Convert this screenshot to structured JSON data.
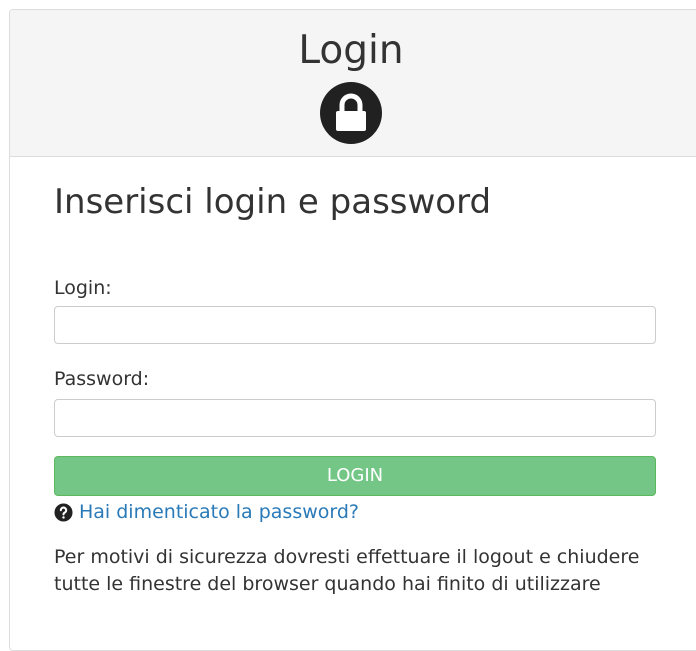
{
  "header": {
    "title": "Login",
    "icon": "lock-icon"
  },
  "form": {
    "heading": "Inserisci login e password",
    "login_label": "Login:",
    "login_value": "",
    "password_label": "Password:",
    "password_value": "",
    "submit_label": "LOGIN",
    "forgot_icon": "question-circle-icon",
    "forgot_label": "Hai dimenticato la password?"
  },
  "notice": {
    "text": "Per motivi di sicurezza dovresti effettuare il logout e chiudere tutte le finestre del browser quando hai finito di utilizzare"
  },
  "colors": {
    "button_bg": "#73c686",
    "link": "#2a7ab8",
    "header_bg": "#f5f5f5",
    "lock_circle": "#212121"
  }
}
